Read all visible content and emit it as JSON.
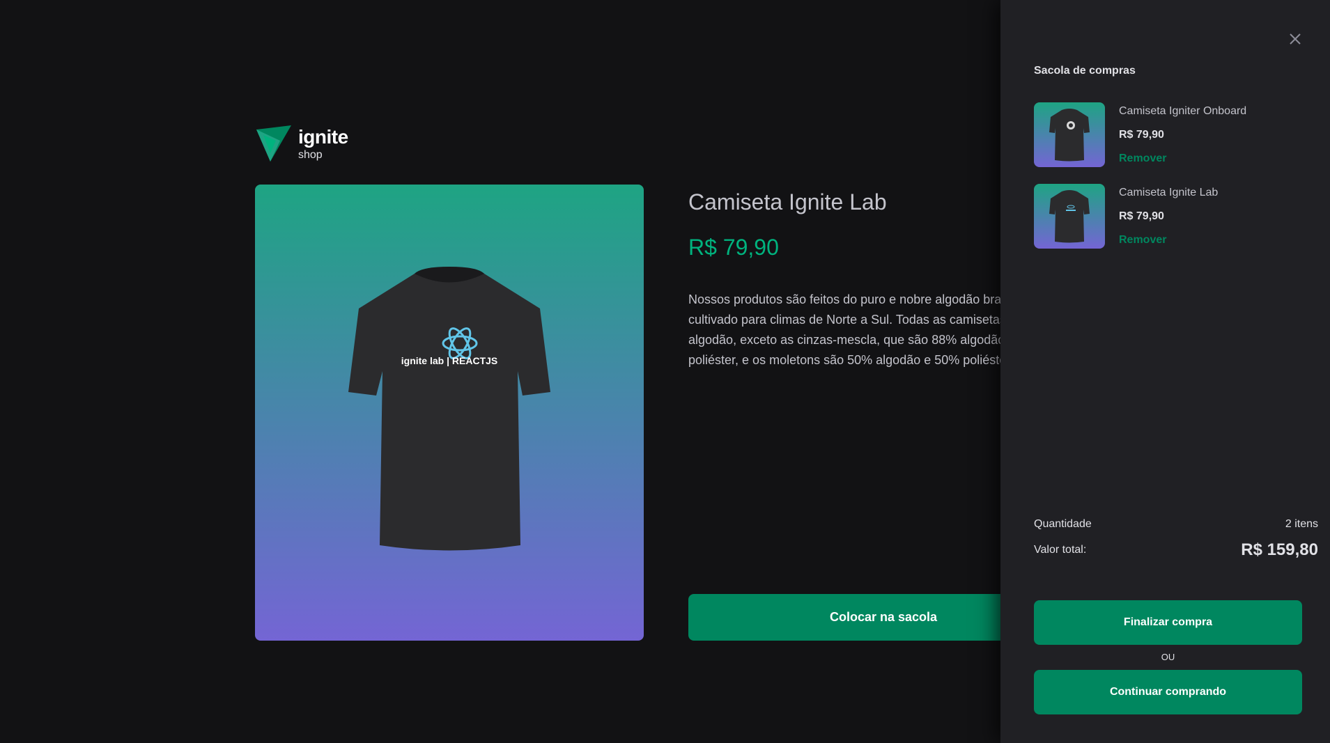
{
  "logo": {
    "title": "ignite",
    "subtitle": "shop",
    "icon": "ignite-logo-icon"
  },
  "product": {
    "title": "Camiseta Ignite Lab",
    "price": "R$ 79,90",
    "description": "Nossos produtos são feitos do puro e nobre algodão brasileiro, cultivado para climas de Norte a Sul. Todas as camisetas são 100% algodão, exceto as cinzas-mescla, que são 88% algodão e 12% poliéster, e os moletons são 50% algodão e 50% poliéster.",
    "add_button": "Colocar na sacola",
    "print_text": "ignite lab | REACTJS"
  },
  "cart": {
    "title": "Sacola de compras",
    "items": [
      {
        "name": "Camiseta Igniter Onboard",
        "price": "R$ 79,90",
        "remove": "Remover"
      },
      {
        "name": "Camiseta Ignite Lab",
        "price": "R$ 79,90",
        "remove": "Remover"
      }
    ],
    "quantity_label": "Quantidade",
    "quantity_value": "2 itens",
    "total_label": "Valor total:",
    "total_value": "R$ 159,80",
    "checkout_button": "Finalizar compra",
    "or_text": "OU",
    "continue_button": "Continuar comprando"
  },
  "colors": {
    "background": "#121214",
    "drawer": "#202024",
    "accent": "#00875f",
    "accent_light": "#00b37e",
    "gradient_top": "#1ea483",
    "gradient_bottom": "#7465d4"
  }
}
